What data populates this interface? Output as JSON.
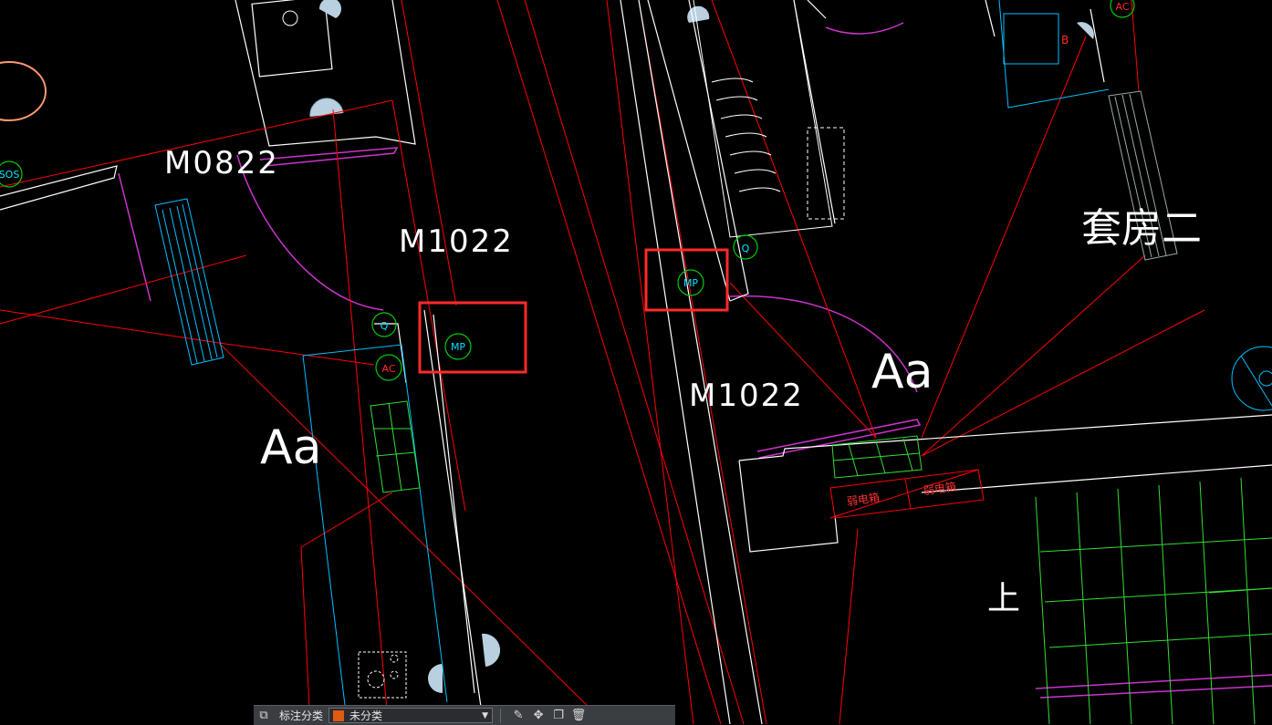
{
  "canvas": {
    "background": "#000000",
    "labels": {
      "door_m0822": "M0822",
      "door_m1022_a": "M1022",
      "door_m1022_b": "M1022",
      "area_aa_left": "Aa",
      "area_aa_right": "Aa",
      "room_suite": "套房二",
      "stair_up": "上"
    },
    "markers": {
      "mp_left": "MP",
      "mp_right": "MP",
      "q_left": "Q",
      "q_right": "Q",
      "ac_left": "AC",
      "ac_top": "AC",
      "sos": "SOS",
      "b_mark": "B"
    },
    "box_labels": {
      "distribution_box_1": "弱电箱",
      "distribution_box_2": "弱电箱"
    },
    "highlight_color": "#ff2a2a",
    "colors": {
      "wall": "#ffffff",
      "wire": "#ff0000",
      "door_arc": "#cc33cc",
      "marker": "#00cc00",
      "cyan": "#00bfff",
      "green_hatch": "#33dd33"
    }
  },
  "toolbar": {
    "label": "标注分类",
    "select_value": "未分类",
    "swatch_color": "#e05a10",
    "icons": [
      "layers-icon",
      "edit-icon",
      "move-icon",
      "copy-icon",
      "delete-icon"
    ]
  }
}
